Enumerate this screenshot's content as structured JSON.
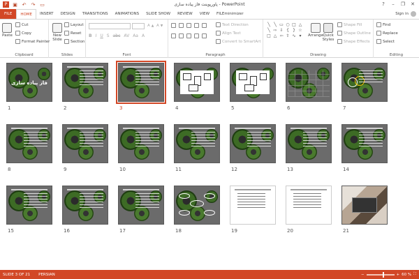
{
  "window": {
    "title": "پاورپوینت فاز پیاده سازی - PowerPoint",
    "help": "?",
    "minimize": "–",
    "restore": "❐",
    "close": "✕"
  },
  "qat": {
    "save_icon": "save-icon",
    "undo_icon": "undo-icon",
    "redo_icon": "redo-icon",
    "start_icon": "start-from-beginning-icon"
  },
  "tabs": [
    "FILE",
    "HOME",
    "INSERT",
    "DESIGN",
    "TRANSITIONS",
    "ANIMATIONS",
    "SLIDE SHOW",
    "REVIEW",
    "VIEW",
    "FILEminimizer"
  ],
  "active_tab": "HOME",
  "signin": "Sign in",
  "ribbon": {
    "clipboard": {
      "label": "Clipboard",
      "paste": "Paste",
      "cut": "Cut",
      "copy": "Copy",
      "format_painter": "Format Painter"
    },
    "slides": {
      "label": "Slides",
      "new_slide": "New Slide",
      "layout": "Layout",
      "reset": "Reset",
      "section": "Section"
    },
    "font": {
      "label": "Font"
    },
    "paragraph": {
      "label": "Paragraph",
      "text_direction": "Text Direction",
      "align_text": "Align Text",
      "convert": "Convert to SmartArt"
    },
    "drawing": {
      "label": "Drawing",
      "arrange": "Arrange",
      "quick_styles": "Quick Styles",
      "shape_fill": "Shape Fill",
      "shape_outline": "Shape Outline",
      "shape_effects": "Shape Effects"
    },
    "editing": {
      "label": "Editing",
      "find": "Find",
      "replace": "Replace",
      "select": "Select"
    }
  },
  "slides": {
    "items": [
      {
        "num": "1",
        "kind": "title",
        "text": "فاز پیاده سازی"
      },
      {
        "num": "2",
        "kind": "bullets"
      },
      {
        "num": "3",
        "kind": "bullets",
        "selected": true
      },
      {
        "num": "4",
        "kind": "diagram"
      },
      {
        "num": "5",
        "kind": "diagram"
      },
      {
        "num": "6",
        "kind": "table"
      },
      {
        "num": "7",
        "kind": "circles"
      },
      {
        "num": "8",
        "kind": "bullets"
      },
      {
        "num": "9",
        "kind": "bullets"
      },
      {
        "num": "10",
        "kind": "bullets"
      },
      {
        "num": "11",
        "kind": "bullets"
      },
      {
        "num": "12",
        "kind": "bullets"
      },
      {
        "num": "13",
        "kind": "bullets"
      },
      {
        "num": "14",
        "kind": "bullets"
      },
      {
        "num": "15",
        "kind": "bullets"
      },
      {
        "num": "16",
        "kind": "bullets"
      },
      {
        "num": "17",
        "kind": "bullets"
      },
      {
        "num": "18",
        "kind": "flow"
      },
      {
        "num": "19",
        "kind": "light"
      },
      {
        "num": "20",
        "kind": "light"
      },
      {
        "num": "21",
        "kind": "photo"
      }
    ]
  },
  "status": {
    "slide_info": "SLIDE 3 OF 21",
    "language": "PERSIAN",
    "zoom": "60 %",
    "zoom_fraction": 0.6,
    "colors": {
      "accent": "#d24726"
    }
  }
}
